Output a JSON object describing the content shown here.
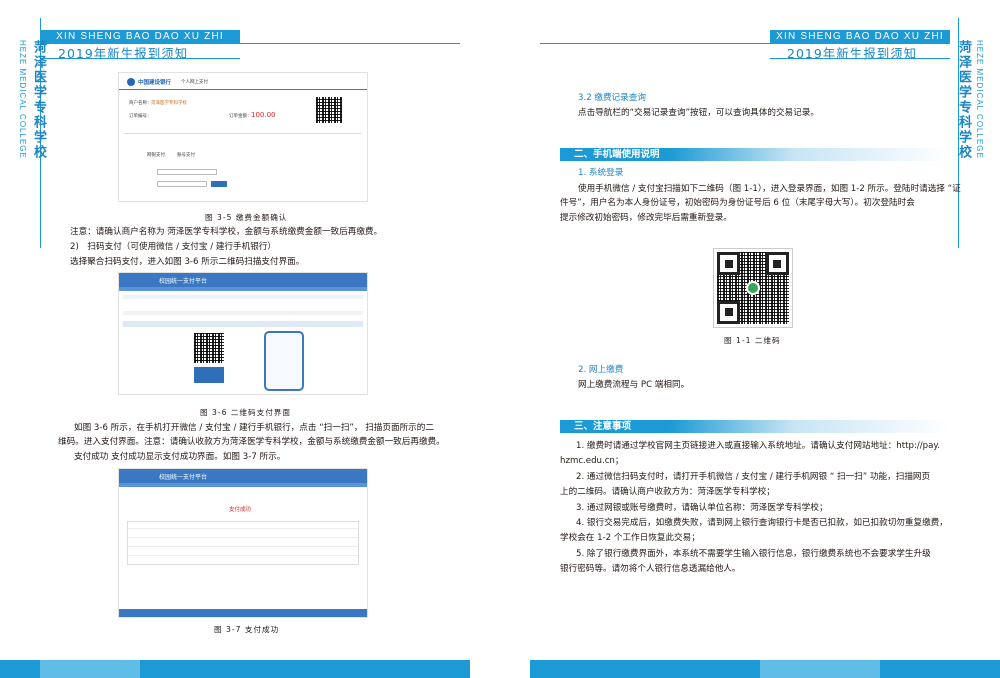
{
  "header": {
    "banner_text": "XIN SHENG BAO DAO XU ZHI",
    "title": "2019年新生报到须知",
    "side_en": "HEZE MEDICAL COLLEGE",
    "side_cn": "菏泽医学专科学校"
  },
  "left": {
    "fig1": {
      "bank_name": "中国建设银行",
      "bank_sub": "个人网上支付",
      "merchant_label": "商户名称：",
      "merchant_value": "菏泽医学专科学校",
      "order_label": "订单编号：",
      "amount_label": "订单金额：",
      "amount_value": "100.00",
      "tab1": "网银支付",
      "tab2": "账号支付",
      "caption": "图 3-5 缴费金额确认"
    },
    "note1": "注意：请确认商户名称为 菏泽医学专科学校，金额与系统缴费金额一致后再缴费。",
    "item2": "2)　扫码支付（可使用微信 / 支付宝 / 建行手机银行）",
    "item2_desc": "选择聚合扫码支付，进入如图 3-6 所示二维码扫描支付界面。",
    "fig2": {
      "platform": "校园统一支付平台",
      "caption": "图 3-6 二维码支付界面"
    },
    "para1_line1": "如图 3-6 所示，在手机打开微信 / 支付宝 / 建行手机银行，点击 “扫一扫”， 扫描页面所示的二",
    "para1_line2": "维码。进入支付界面。注意：请确认收款方为菏泽医学专科学校，金额与系统缴费金额一致后再缴费。",
    "para2": "支付成功 支付成功显示支付成功界面。如图 3-7 所示。",
    "fig3": {
      "platform": "校园统一支付平台",
      "success_title": "支付成功",
      "caption": "图 3-7 支付成功"
    }
  },
  "right": {
    "s32_title": "3.2 缴费记录查询",
    "s32_text": "点击导航栏的“交易记录查询”按钮，可以查询具体的交易记录。",
    "sec2": "二、手机端使用说明",
    "s1_title": "1.  系统登录",
    "s1_line1": "使用手机微信 / 支付宝扫描如下二维码（图 1-1），进入登录界面，如图 1-2 所示。登陆时请选择 “证",
    "s1_line2": "件号”，用户名为本人身份证号，初始密码为身份证号后 6 位（末尾字母大写）。初次登陆时会",
    "s1_line3": "提示修改初始密码，修改完毕后需重新登录。",
    "qr_caption": "图 1-1 二维码",
    "s2_title": "2.  网上缴费",
    "s2_text": "网上缴费流程与 PC 端相同。",
    "sec3": "三、注意事项",
    "n1_line1": "1. 缴费时请通过学校官网主页链接进入或直接输入系统地址。请确认支付网站地址：http://pay.",
    "n1_line2": "hzmc.edu.cn；",
    "n2_line1": "2. 通过微信扫码支付时，请打开手机微信 / 支付宝 / 建行手机网银 “ 扫一扫” 功能，扫描网页",
    "n2_line2": "上的二维码。请确认商户收款方为：菏泽医学专科学校；",
    "n3": "3. 通过网银或账号缴费时，请确认单位名称：菏泽医学专科学校；",
    "n4_line1": "4. 银行交易完成后，如缴费失败，请到网上银行查询银行卡是否已扣款，如已扣款切勿重复缴费，",
    "n4_line2": "学校会在 1-2 个工作日恢复此交易；",
    "n5_line1": "5. 除了银行缴费界面外，本系统不需要学生输入银行信息，银行缴费系统也不会要求学生升级",
    "n5_line2": "银行密码等。请勿将个人银行信息透漏给他人。"
  },
  "colors": {
    "accent": "#1b9ad6",
    "title": "#1b86c6"
  }
}
